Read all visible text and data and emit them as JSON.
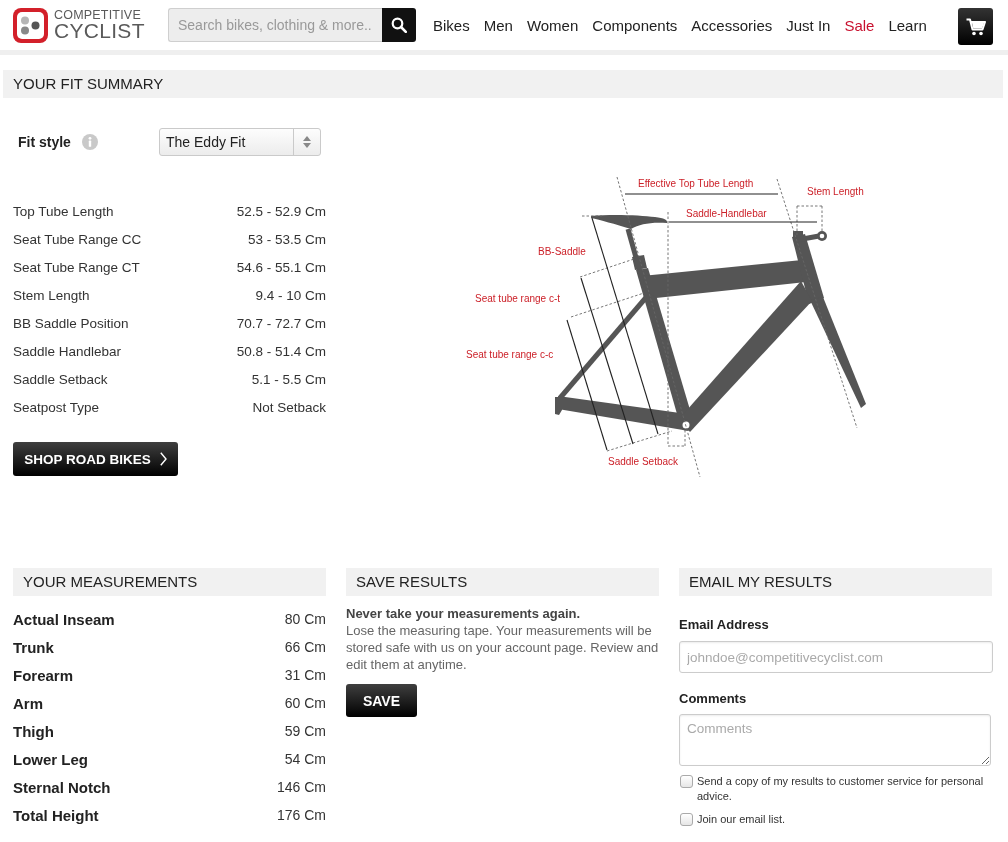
{
  "header": {
    "logo": {
      "line1": "COMPETITIVE",
      "line2": "CYCLIST"
    },
    "search": {
      "placeholder": "Search bikes, clothing & more..."
    },
    "nav": [
      {
        "label": "Bikes",
        "color": "#222222"
      },
      {
        "label": "Men",
        "color": "#222222"
      },
      {
        "label": "Women",
        "color": "#222222"
      },
      {
        "label": "Components",
        "color": "#222222"
      },
      {
        "label": "Accessories",
        "color": "#222222"
      },
      {
        "label": "Just In",
        "color": "#222222"
      },
      {
        "label": "Sale",
        "color": "#c8102e"
      },
      {
        "label": "Learn",
        "color": "#222222"
      }
    ]
  },
  "fit_summary": {
    "title": "YOUR FIT SUMMARY",
    "fit_style": {
      "label": "Fit style",
      "value": "The Eddy Fit"
    },
    "rows": [
      {
        "name": "Top Tube Length",
        "value": "52.5 - 52.9 Cm"
      },
      {
        "name": "Seat Tube Range CC",
        "value": "53 - 53.5 Cm"
      },
      {
        "name": "Seat Tube Range CT",
        "value": "54.6 - 55.1 Cm"
      },
      {
        "name": "Stem Length",
        "value": "9.4 - 10 Cm"
      },
      {
        "name": "BB Saddle Position",
        "value": "70.7 - 72.7 Cm"
      },
      {
        "name": "Saddle Handlebar",
        "value": "50.8 - 51.4 Cm"
      },
      {
        "name": "Saddle Setback",
        "value": "5.1 - 5.5 Cm"
      },
      {
        "name": "Seatpost Type",
        "value": "Not Setback"
      }
    ],
    "button": "SHOP ROAD BIKES",
    "diagram": {
      "labels": [
        "Effective Top Tube Length",
        "Stem Length",
        "Saddle-Handlebar",
        "BB-Saddle",
        "Seat tube range c-t",
        "Seat tube range c-c",
        "Saddle Setback"
      ]
    }
  },
  "measurements": {
    "title": "YOUR MEASUREMENTS",
    "rows": [
      {
        "name": "Actual Inseam",
        "value": "80 Cm"
      },
      {
        "name": "Trunk",
        "value": "66 Cm"
      },
      {
        "name": "Forearm",
        "value": "31 Cm"
      },
      {
        "name": "Arm",
        "value": "60 Cm"
      },
      {
        "name": "Thigh",
        "value": "59 Cm"
      },
      {
        "name": "Lower Leg",
        "value": "54 Cm"
      },
      {
        "name": "Sternal Notch",
        "value": "146 Cm"
      },
      {
        "name": "Total Height",
        "value": "176 Cm"
      }
    ]
  },
  "save_results": {
    "title": "SAVE RESULTS",
    "heading": "Never take your measurements again.",
    "description": "Lose the measuring tape. Your measurements will be stored safe with us on your account page. Review and edit them at anytime.",
    "button": "SAVE"
  },
  "email_results": {
    "title": "EMAIL MY RESULTS",
    "email": {
      "label": "Email Address",
      "placeholder": "johndoe@competitivecyclist.com"
    },
    "comments": {
      "label": "Comments",
      "placeholder": "Comments"
    },
    "options": [
      {
        "label": "Send a copy of my results to customer service for personal advice.",
        "checked": false
      },
      {
        "label": "Join our email list.",
        "checked": false
      }
    ]
  }
}
